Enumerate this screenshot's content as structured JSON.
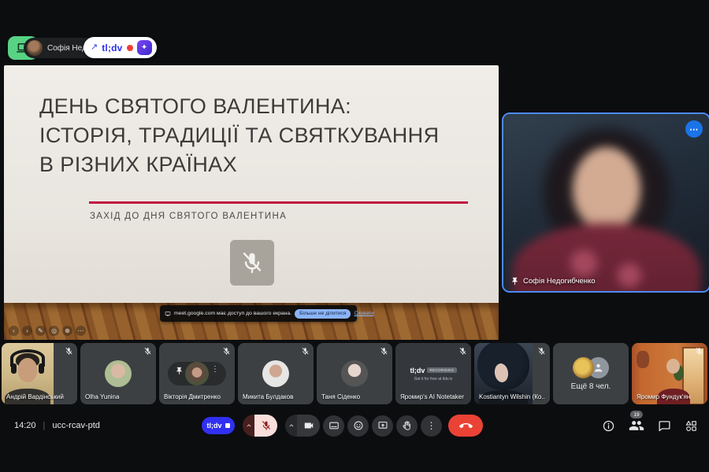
{
  "colors": {
    "tldv_blue": "#3130f0",
    "meet_blue": "#1a73e8",
    "pinned_border": "#4c8bf5",
    "end_call_red": "#ea4335",
    "mic_muted_bg": "#f9dedc",
    "share_green": "#57d383",
    "toast_button_blue": "#8ab4f8",
    "slide_accent": "#c11240",
    "record_dot": "#ef4037"
  },
  "glyphs": {
    "prev": "‹",
    "next": "›",
    "pen": "✎",
    "laser": "◎",
    "zoom": "⊕",
    "more": "⋯",
    "dots_h": "⋯",
    "dots_v": "⋮",
    "cursor": "↗",
    "sparkle": "✦",
    "divider": "|"
  },
  "top_bar": {
    "presenter_name": "Софія Недогибченко",
    "tldv_brand": "tl;dv"
  },
  "slide": {
    "title_lines": [
      "ДЕНЬ СВЯТОГО ВАЛЕНТИНА:",
      "ІСТОРІЯ, ТРАДИЦІЇ ТА СВЯТКУВАННЯ",
      "В РІЗНИХ КРАЇНАХ"
    ],
    "subtitle": "ЗАХІД ДО ДНЯ СВЯТОГО ВАЛЕНТИНА",
    "toast": {
      "message": "meet.google.com має доступ до вашого екрана.",
      "primary_button": "Більше не ділитися",
      "secondary_link": "Сховати"
    }
  },
  "pinned": {
    "name": "Софія Недогибченко"
  },
  "filmstrip": [
    {
      "name": "Андрій Вардінський",
      "type": "video",
      "muted": true
    },
    {
      "name": "Olha Yunina",
      "type": "avatar",
      "muted": true
    },
    {
      "name": "Вікторія Дмитренко",
      "type": "avatar",
      "muted": true
    },
    {
      "name": "Микита Булдаков",
      "type": "avatar",
      "muted": true
    },
    {
      "name": "Таня Сіденко",
      "type": "avatar",
      "muted": true
    },
    {
      "name": "Яромир's AI Notetaker",
      "type": "logo",
      "muted": true
    },
    {
      "name": "Kostiantyn Wilshin (Ко...",
      "type": "video",
      "muted": true
    },
    {
      "name": "Ещё 8 чел.",
      "type": "overflow",
      "muted": false
    },
    {
      "name": "Яромир Фундук'ян",
      "type": "video",
      "muted": true
    }
  ],
  "notetaker": {
    "logo": "tl;dv",
    "badge": "RECORDING",
    "subtext": "Get it for free at tldv.io"
  },
  "control_bar": {
    "time": "14:20",
    "meeting_code": "ucc-rcav-ptd",
    "tldv_label": "tl;dv",
    "participants_badge": "19"
  }
}
